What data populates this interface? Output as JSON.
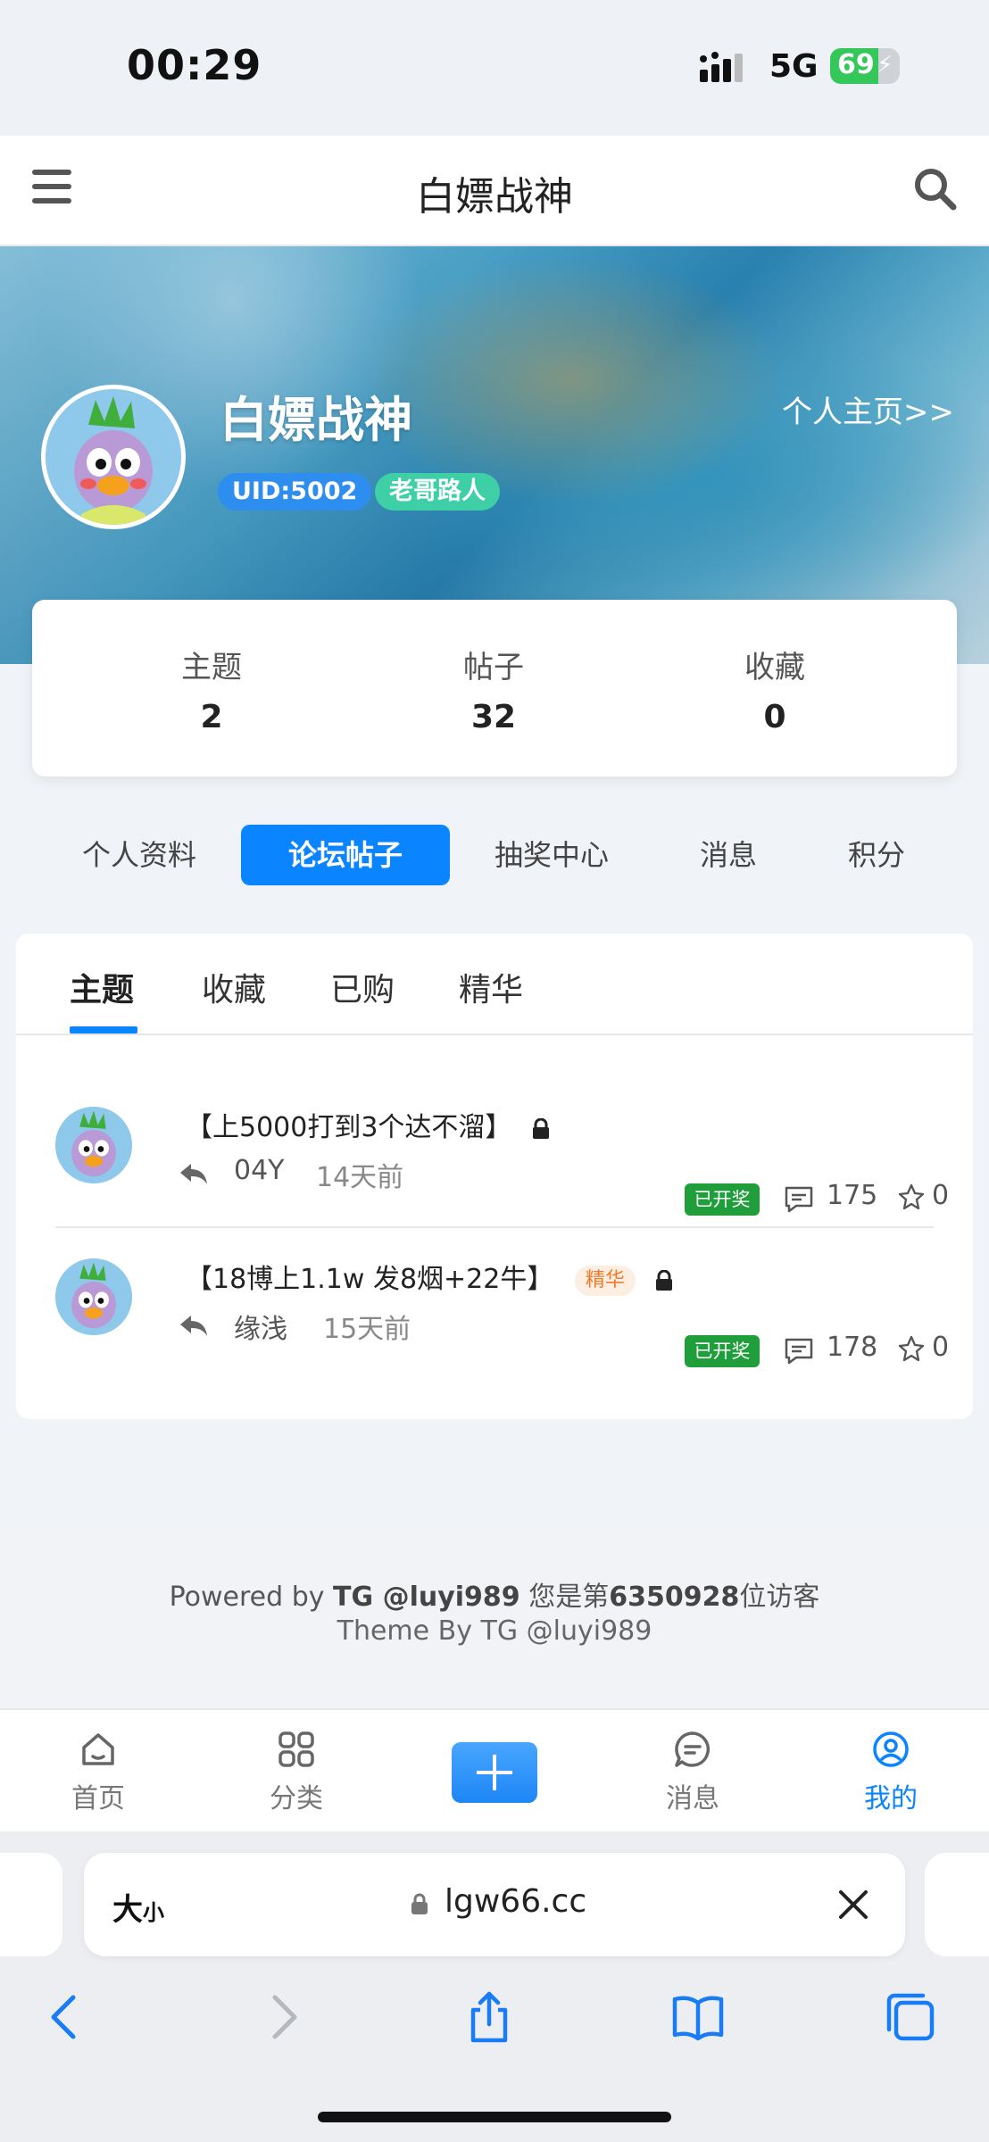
{
  "status_bar": {
    "time": "00:29",
    "network": "5G",
    "battery": "69",
    "battery_level": 0.69
  },
  "top_nav": {
    "title": "白嫖战神"
  },
  "profile": {
    "name": "白嫖战神",
    "uid": "UID:5002",
    "level": "老哥路人",
    "homepage_link": "个人主页>>"
  },
  "stats": [
    {
      "label": "主题",
      "value": "2"
    },
    {
      "label": "帖子",
      "value": "32"
    },
    {
      "label": "收藏",
      "value": "0"
    }
  ],
  "profile_tabs": [
    "个人资料",
    "论坛帖子",
    "抽奖中心",
    "消息",
    "积分"
  ],
  "sub_tabs": [
    "主题",
    "收藏",
    "已购",
    "精华"
  ],
  "posts": [
    {
      "title": "【上5000打到3个达不溜】",
      "tag": "",
      "author": "04Y",
      "time": "14天前",
      "badge": "已开奖",
      "comments": "175",
      "stars": "0"
    },
    {
      "title": "【18博上1.1w 发8烟+22牛】",
      "tag": "精华",
      "author": "缘浅",
      "time": "15天前",
      "badge": "已开奖",
      "comments": "178",
      "stars": "0"
    }
  ],
  "footer": {
    "powered_prefix": "Powered by ",
    "powered_tg": "TG @luyi989",
    "visitor_prefix": " 您是第",
    "visitor_count": "6350928",
    "visitor_suffix": "位访客",
    "theme": "Theme By TG @luyi989"
  },
  "tab_bar": [
    "首页",
    "分类",
    "消息",
    "我的"
  ],
  "browser": {
    "text_size_big": "大",
    "text_size_small": "小",
    "url": "lgw66.cc"
  },
  "colors": {
    "accent": "#0a84ff",
    "award_badge": "#1f9e3b",
    "essence_tag": "#f07a2a"
  }
}
